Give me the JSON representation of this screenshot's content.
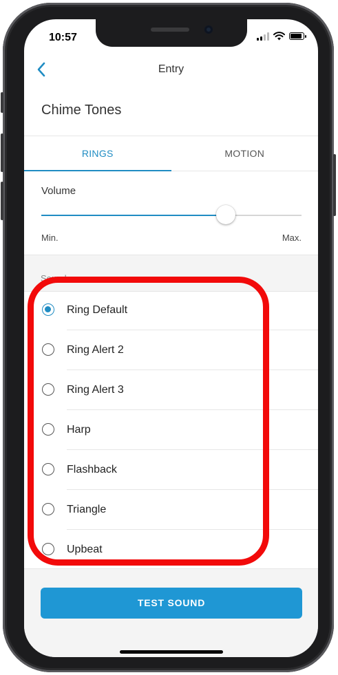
{
  "status_bar": {
    "time": "10:57"
  },
  "nav": {
    "title": "Entry"
  },
  "page": {
    "title": "Chime Tones"
  },
  "tabs": [
    {
      "label": "RINGS",
      "active": true
    },
    {
      "label": "MOTION",
      "active": false
    }
  ],
  "volume": {
    "label": "Volume",
    "min_label": "Min.",
    "max_label": "Max.",
    "level_fraction": 0.71
  },
  "sounds": {
    "header": "Sounds",
    "selected": "Ring Default",
    "items": [
      {
        "label": "Ring Default",
        "checked": true
      },
      {
        "label": "Ring Alert 2",
        "checked": false
      },
      {
        "label": "Ring Alert 3",
        "checked": false
      },
      {
        "label": "Harp",
        "checked": false
      },
      {
        "label": "Flashback",
        "checked": false
      },
      {
        "label": "Triangle",
        "checked": false
      },
      {
        "label": "Upbeat",
        "checked": false
      }
    ]
  },
  "actions": {
    "test_sound_label": "TEST SOUND"
  },
  "colors": {
    "accent": "#1f8cc3",
    "button": "#1f97d4",
    "highlight": "#f20a0a"
  },
  "icons": [
    "back-chevron-icon",
    "cellular-signal-icon",
    "wifi-icon",
    "battery-icon",
    "radio-icon"
  ]
}
